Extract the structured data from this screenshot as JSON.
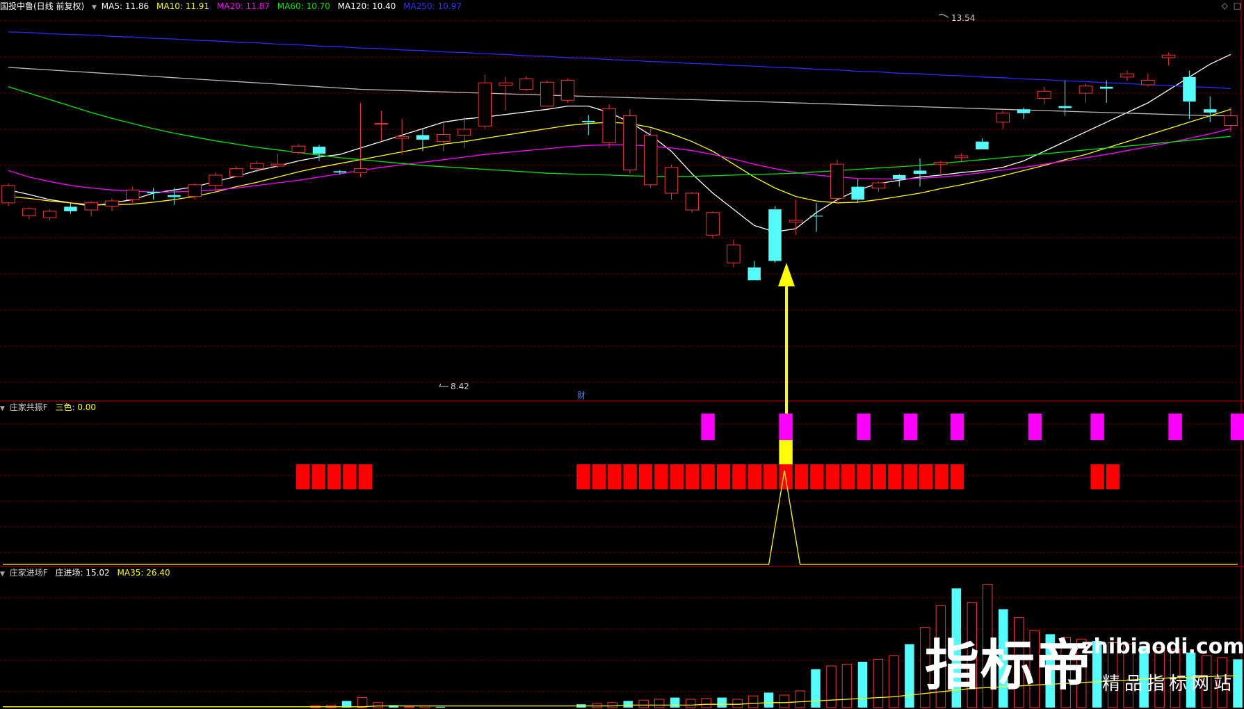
{
  "header_main": {
    "stock": "国投中鲁(日线 前复权)",
    "ma5": "MA5: 11.86",
    "ma10": "MA10: 11.91",
    "ma20": "MA20: 11.87",
    "ma60": "MA60: 10.70",
    "ma120": "MA120: 10.40",
    "ma250": "MA250: 10.97"
  },
  "header_p2": {
    "name": "庄家共振F",
    "item": "三色: 0.00"
  },
  "header_p3": {
    "name": "庄家进场F",
    "item1": "庄进场: 15.02",
    "item2": "MA35: 26.40"
  },
  "markers": {
    "high": "13.54",
    "low": "8.42",
    "cai": "财"
  },
  "watermark": {
    "big": "指标帝",
    "url": "zhibiaodi.com",
    "sub": "精品指标网站"
  },
  "colors": {
    "up": "#ff3232",
    "down": "#54fcfc",
    "ma5": "#ffffff",
    "ma10": "#ffff00",
    "ma20": "#ff00ff",
    "ma60": "#00e600",
    "ma120": "#bbbbbb",
    "ma250": "#2a2aff",
    "grid": "#7a0000",
    "magenta_block": "#ff00ff",
    "red_block": "#ff0000",
    "yellow_block": "#ffff00"
  },
  "chart_data": [
    {
      "type": "candlestick",
      "title": "国投中鲁(日线 前复权)",
      "ylim": [
        8.0,
        14.0
      ],
      "candles": [
        [
          11.05,
          11.32,
          11.0,
          11.35
        ],
        [
          10.85,
          10.96,
          10.8,
          10.98
        ],
        [
          10.82,
          10.92,
          10.78,
          10.95
        ],
        [
          10.99,
          10.92,
          10.88,
          11.05
        ],
        [
          10.94,
          11.05,
          10.85,
          11.08
        ],
        [
          11.0,
          11.08,
          10.92,
          11.12
        ],
        [
          11.1,
          11.25,
          11.05,
          11.3
        ],
        [
          11.22,
          11.2,
          11.1,
          11.28
        ],
        [
          11.17,
          11.14,
          11.02,
          11.28
        ],
        [
          11.15,
          11.33,
          11.1,
          11.35
        ],
        [
          11.32,
          11.48,
          11.22,
          11.52
        ],
        [
          11.46,
          11.58,
          11.45,
          11.62
        ],
        [
          11.58,
          11.66,
          11.52,
          11.7
        ],
        [
          11.62,
          11.65,
          11.59,
          11.81
        ],
        [
          11.83,
          11.93,
          11.8,
          11.96
        ],
        [
          11.92,
          11.81,
          11.7,
          11.95
        ],
        [
          11.54,
          11.52,
          11.49,
          11.56
        ],
        [
          11.52,
          11.58,
          11.45,
          12.6
        ],
        [
          12.28,
          12.28,
          12.0,
          12.48
        ],
        [
          12.05,
          12.08,
          11.8,
          12.35
        ],
        [
          12.1,
          12.03,
          11.85,
          12.2
        ],
        [
          12.0,
          12.11,
          11.85,
          12.32
        ],
        [
          12.1,
          12.19,
          11.9,
          12.38
        ],
        [
          12.24,
          12.91,
          12.2,
          13.04
        ],
        [
          12.87,
          12.91,
          12.48,
          13.0
        ],
        [
          12.81,
          12.97,
          12.78,
          13.01
        ],
        [
          12.55,
          12.92,
          12.9,
          12.95
        ],
        [
          12.64,
          12.95,
          12.6,
          12.98
        ],
        [
          12.32,
          12.3,
          12.1,
          12.41
        ],
        [
          11.98,
          12.51,
          11.9,
          12.58
        ],
        [
          11.56,
          12.4,
          11.5,
          12.5
        ],
        [
          11.33,
          12.1,
          11.28,
          12.2
        ],
        [
          11.2,
          11.6,
          11.1,
          11.64
        ],
        [
          10.94,
          11.2,
          10.9,
          11.22
        ],
        [
          10.55,
          10.9,
          10.5,
          10.92
        ],
        [
          10.12,
          10.4,
          10.05,
          10.48
        ],
        [
          10.05,
          9.85,
          9.86,
          10.15
        ],
        [
          10.95,
          10.15,
          10.12,
          11.0
        ],
        [
          10.75,
          10.78,
          10.55,
          11.1
        ],
        [
          10.85,
          10.84,
          10.6,
          11.05
        ],
        [
          11.12,
          11.65,
          11.05,
          11.72
        ],
        [
          11.3,
          11.1,
          11.05,
          11.42
        ],
        [
          11.28,
          11.36,
          11.22,
          11.38
        ],
        [
          11.48,
          11.42,
          11.3,
          11.5
        ],
        [
          11.55,
          11.5,
          11.3,
          11.74
        ],
        [
          11.65,
          11.68,
          11.5,
          11.7
        ],
        [
          11.75,
          11.78,
          11.7,
          11.82
        ],
        [
          12.0,
          11.88,
          11.9,
          12.05
        ],
        [
          12.3,
          12.44,
          12.2,
          12.48
        ],
        [
          12.5,
          12.44,
          12.35,
          12.53
        ],
        [
          12.67,
          12.78,
          12.58,
          12.85
        ],
        [
          12.55,
          12.52,
          12.4,
          12.95
        ],
        [
          12.75,
          12.86,
          12.6,
          12.9
        ],
        [
          12.85,
          12.82,
          12.6,
          12.95
        ],
        [
          13.0,
          13.05,
          12.94,
          13.1
        ],
        [
          12.88,
          12.95,
          12.85,
          13.05
        ],
        [
          13.3,
          13.34,
          13.18,
          13.38
        ],
        [
          13.0,
          12.62,
          12.35,
          13.1
        ],
        [
          12.5,
          12.45,
          12.3,
          12.7
        ],
        [
          12.25,
          12.4,
          12.15,
          12.53
        ]
      ],
      "series": [
        {
          "name": "MA5",
          "values": [
            11.25,
            11.18,
            11.1,
            11.05,
            11.0,
            11.05,
            11.1,
            11.2,
            11.25,
            11.3,
            11.38,
            11.46,
            11.55,
            11.62,
            11.7,
            11.76,
            11.8,
            11.9,
            12.0,
            12.1,
            12.2,
            12.3,
            12.35,
            12.38,
            12.42,
            12.46,
            12.5,
            12.55,
            12.55,
            12.45,
            12.3,
            12.1,
            11.85,
            11.5,
            11.2,
            10.95,
            10.7,
            10.6,
            10.65,
            10.9,
            11.1,
            11.25,
            11.35,
            11.4,
            11.45,
            11.48,
            11.52,
            11.55,
            11.6,
            11.7,
            11.85,
            12.0,
            12.15,
            12.3,
            12.45,
            12.6,
            12.8,
            13.0,
            13.2,
            13.35
          ]
        },
        {
          "name": "MA10",
          "values": [
            11.15,
            11.12,
            11.08,
            11.05,
            11.02,
            11.02,
            11.03,
            11.06,
            11.1,
            11.15,
            11.22,
            11.3,
            11.37,
            11.45,
            11.53,
            11.6,
            11.66,
            11.72,
            11.78,
            11.84,
            11.9,
            11.96,
            12.0,
            12.05,
            12.1,
            12.15,
            12.2,
            12.25,
            12.28,
            12.3,
            12.28,
            12.22,
            12.12,
            12.0,
            11.85,
            11.65,
            11.45,
            11.28,
            11.15,
            11.08,
            11.05,
            11.06,
            11.1,
            11.15,
            11.2,
            11.27,
            11.33,
            11.4,
            11.47,
            11.55,
            11.63,
            11.72,
            11.8,
            11.9,
            12.0,
            12.1,
            12.2,
            12.3,
            12.4,
            12.5
          ]
        },
        {
          "name": "MA20",
          "values": [
            11.55,
            11.45,
            11.38,
            11.32,
            11.28,
            11.25,
            11.23,
            11.22,
            11.22,
            11.23,
            11.25,
            11.28,
            11.32,
            11.36,
            11.4,
            11.45,
            11.5,
            11.55,
            11.6,
            11.64,
            11.68,
            11.72,
            11.76,
            11.8,
            11.83,
            11.86,
            11.89,
            11.92,
            11.94,
            11.95,
            11.95,
            11.93,
            11.9,
            11.86,
            11.8,
            11.73,
            11.65,
            11.58,
            11.52,
            11.48,
            11.45,
            11.43,
            11.42,
            11.42,
            11.43,
            11.45,
            11.48,
            11.52,
            11.56,
            11.6,
            11.65,
            11.7,
            11.75,
            11.8,
            11.86,
            11.92,
            11.98,
            12.05,
            12.12,
            12.2
          ]
        },
        {
          "name": "MA60",
          "values": [
            12.85,
            12.75,
            12.65,
            12.55,
            12.45,
            12.36,
            12.28,
            12.2,
            12.13,
            12.07,
            12.01,
            11.96,
            11.91,
            11.87,
            11.83,
            11.79,
            11.75,
            11.72,
            11.69,
            11.66,
            11.63,
            11.61,
            11.59,
            11.57,
            11.55,
            11.53,
            11.51,
            11.5,
            11.49,
            11.48,
            11.47,
            11.46,
            11.46,
            11.46,
            11.47,
            11.48,
            11.49,
            11.5,
            11.51,
            11.53,
            11.55,
            11.57,
            11.59,
            11.61,
            11.63,
            11.66,
            11.69,
            11.72,
            11.75,
            11.78,
            11.81,
            11.84,
            11.87,
            11.9,
            11.93,
            11.96,
            11.99,
            12.02,
            12.05,
            12.08
          ]
        },
        {
          "name": "MA120",
          "values": [
            13.15,
            13.13,
            13.11,
            13.09,
            13.07,
            13.05,
            13.03,
            13.01,
            12.99,
            12.97,
            12.95,
            12.93,
            12.91,
            12.89,
            12.87,
            12.85,
            12.83,
            12.81,
            12.8,
            12.79,
            12.78,
            12.77,
            12.76,
            12.75,
            12.74,
            12.73,
            12.72,
            12.71,
            12.7,
            12.69,
            12.68,
            12.67,
            12.66,
            12.65,
            12.64,
            12.63,
            12.62,
            12.61,
            12.6,
            12.59,
            12.58,
            12.57,
            12.56,
            12.55,
            12.54,
            12.53,
            12.52,
            12.51,
            12.5,
            12.49,
            12.48,
            12.47,
            12.46,
            12.45,
            12.44,
            12.43,
            12.42,
            12.41,
            12.4,
            12.4
          ]
        },
        {
          "name": "MA250",
          "values": [
            13.7,
            13.69,
            13.67,
            13.66,
            13.65,
            13.63,
            13.62,
            13.6,
            13.59,
            13.57,
            13.56,
            13.54,
            13.53,
            13.51,
            13.5,
            13.48,
            13.47,
            13.45,
            13.44,
            13.42,
            13.41,
            13.39,
            13.38,
            13.36,
            13.35,
            13.33,
            13.32,
            13.3,
            13.29,
            13.27,
            13.26,
            13.24,
            13.23,
            13.21,
            13.2,
            13.18,
            13.17,
            13.15,
            13.14,
            13.12,
            13.11,
            13.09,
            13.08,
            13.06,
            13.05,
            13.03,
            13.02,
            13.0,
            12.99,
            12.97,
            12.96,
            12.94,
            12.93,
            12.91,
            12.9,
            12.88,
            12.87,
            12.85,
            12.84,
            12.82
          ]
        }
      ]
    },
    {
      "type": "bar",
      "title": "庄家共振F",
      "columns": 80,
      "magenta_cols": [
        45,
        50,
        55,
        58,
        61,
        66,
        70,
        75,
        79
      ],
      "yellow_cols": [
        50
      ],
      "red_cols": [
        19,
        20,
        21,
        22,
        23,
        37,
        38,
        39,
        40,
        41,
        42,
        43,
        44,
        45,
        46,
        47,
        48,
        49,
        50,
        51,
        52,
        53,
        54,
        55,
        56,
        57,
        58,
        59,
        60,
        61,
        70,
        71
      ],
      "series": [
        {
          "name": "三色",
          "values": [
            0,
            0,
            0,
            0,
            0,
            0,
            0,
            0,
            0,
            0,
            0,
            0,
            0,
            0,
            0,
            0,
            0,
            0,
            0,
            0,
            0,
            0,
            0,
            0,
            0,
            0,
            0,
            0,
            0,
            0,
            0,
            0,
            0,
            0,
            0,
            0,
            0,
            0,
            0,
            0,
            0,
            0,
            0,
            0,
            0,
            0,
            0,
            0,
            0,
            0,
            1,
            0,
            0,
            0,
            0,
            0,
            0,
            0,
            0,
            0,
            0,
            0,
            0,
            0,
            0,
            0,
            0,
            0,
            0,
            0,
            0,
            0,
            0,
            0,
            0,
            0,
            0,
            0,
            0,
            0
          ]
        }
      ]
    },
    {
      "type": "bar",
      "title": "庄家进场F",
      "ylim": [
        0,
        160
      ],
      "series": [
        {
          "name": "庄进场",
          "values": [
            0,
            0,
            0,
            0,
            0,
            0,
            0,
            0,
            0,
            0,
            0,
            0,
            0,
            0,
            0,
            0,
            0,
            0,
            0,
            0,
            2,
            3,
            8,
            12,
            6,
            3,
            1,
            2,
            1,
            0,
            0,
            0,
            0,
            0,
            0,
            0,
            0,
            4,
            5,
            6,
            8,
            9,
            10,
            12,
            10,
            11,
            12,
            10,
            14,
            18,
            15,
            20,
            46,
            50,
            52,
            55,
            58,
            62,
            76,
            96,
            122,
            143,
            126,
            148,
            118,
            108,
            92,
            88,
            84,
            82,
            80,
            78,
            76,
            74,
            72,
            70,
            66,
            62,
            60,
            58
          ]
        },
        {
          "name": "MA35",
          "values": [
            1,
            1,
            1,
            1,
            1,
            1,
            1,
            1,
            1,
            1,
            1,
            1,
            1,
            1,
            1,
            1,
            1,
            1,
            1,
            1,
            1,
            1,
            1,
            1,
            2,
            2,
            2,
            2,
            2,
            2,
            2,
            2,
            2,
            2,
            2,
            2,
            2,
            2,
            2,
            2,
            3,
            3,
            3,
            3,
            3,
            4,
            4,
            4,
            5,
            6,
            6,
            7,
            8,
            9,
            10,
            11,
            12,
            13,
            15,
            17,
            19,
            21,
            23,
            24,
            25,
            26,
            27,
            28,
            29,
            30,
            31,
            32,
            33,
            34,
            35,
            36,
            36,
            37,
            38,
            38
          ]
        }
      ]
    }
  ]
}
